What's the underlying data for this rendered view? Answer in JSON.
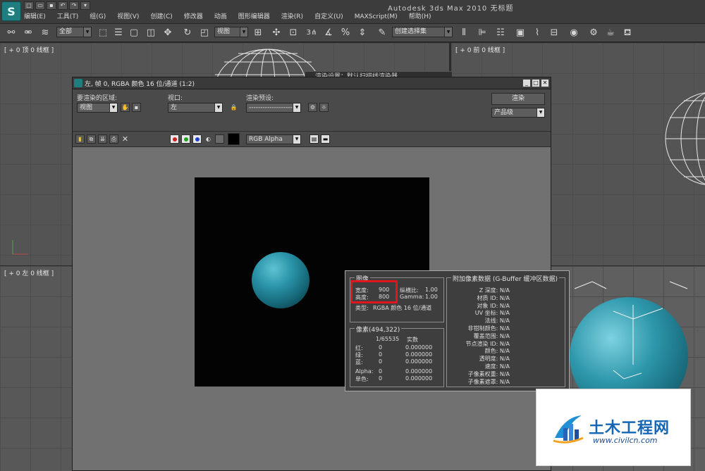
{
  "app": {
    "title": "Autodesk 3ds Max  2010    无标题",
    "menus": [
      "编辑(E)",
      "工具(T)",
      "组(G)",
      "视图(V)",
      "创建(C)",
      "修改器",
      "动画",
      "图形编辑器",
      "渲染(R)",
      "自定义(U)",
      "MAXScript(M)",
      "帮助(H)"
    ]
  },
  "toolbar": {
    "selection_filter": "全部",
    "reference_coord": "视图",
    "snap_label": "3",
    "named_selection": "创建选择集"
  },
  "viewports": {
    "top_label": "[ + 0 顶 0 线框 ]",
    "front_label": "[ + 0 前 0 线框 ]",
    "left_label": "[ + 0 左 0 线框 ]"
  },
  "background_dialog": {
    "title": "渲染设置：默认扫描线渲染器"
  },
  "render_window": {
    "title": "左, 帧 0, RGBA 颜色 16 位/通道 (1:2)",
    "area_label": "要渲染的区域:",
    "area_value": "视图",
    "viewport_label": "视口:",
    "viewport_value": "左",
    "preset_label": "渲染预设:",
    "preset_value": "-------------------",
    "render_button": "渲染",
    "quality_value": "产品级",
    "channel_value": "RGB Alpha"
  },
  "info_panel": {
    "image_group": "图像",
    "width_label": "宽度:",
    "width_value": "900",
    "height_label": "高度:",
    "height_value": "800",
    "aspect_label": "纵横比:",
    "aspect_value": "1.00",
    "gamma_label": "Gamma:",
    "gamma_value": "1.00",
    "type_label": "类型:",
    "type_value": "RGBA 颜色 16 位/通道",
    "pixel_group": "像素(494,322)",
    "scale_label": "1/65535",
    "real_label": "实数",
    "rows": [
      {
        "label": "红:",
        "v1": "0",
        "v2": "0.000000"
      },
      {
        "label": "绿:",
        "v1": "0",
        "v2": "0.000000"
      },
      {
        "label": "蓝:",
        "v1": "0",
        "v2": "0.000000"
      },
      {
        "label": "Alpha:",
        "v1": "0",
        "v2": "0.000000"
      },
      {
        "label": "单色:",
        "v1": "0",
        "v2": "0.000000"
      }
    ],
    "gbuffer_group": "附加像素数据 (G-Buffer 缓冲区数据)",
    "gbuffer": [
      "Z 深度: N/A",
      "材质 ID: N/A",
      "对象 ID: N/A",
      "UV 坐标: N/A",
      "法线: N/A",
      "非钳制颜色: N/A",
      "覆盖范围: N/A",
      "节点渲染 ID: N/A",
      "颜色: N/A",
      "透明度: N/A",
      "速度: N/A",
      "子像素权重: N/A",
      "子像素遮罩: N/A"
    ]
  },
  "watermark": {
    "brand": "土木工程网",
    "url": "www.civilcn.com"
  },
  "colors": {
    "accent_teal": "#1f7d7f",
    "highlight_red": "#e0161a",
    "watermark_blue": "#1567b5"
  }
}
